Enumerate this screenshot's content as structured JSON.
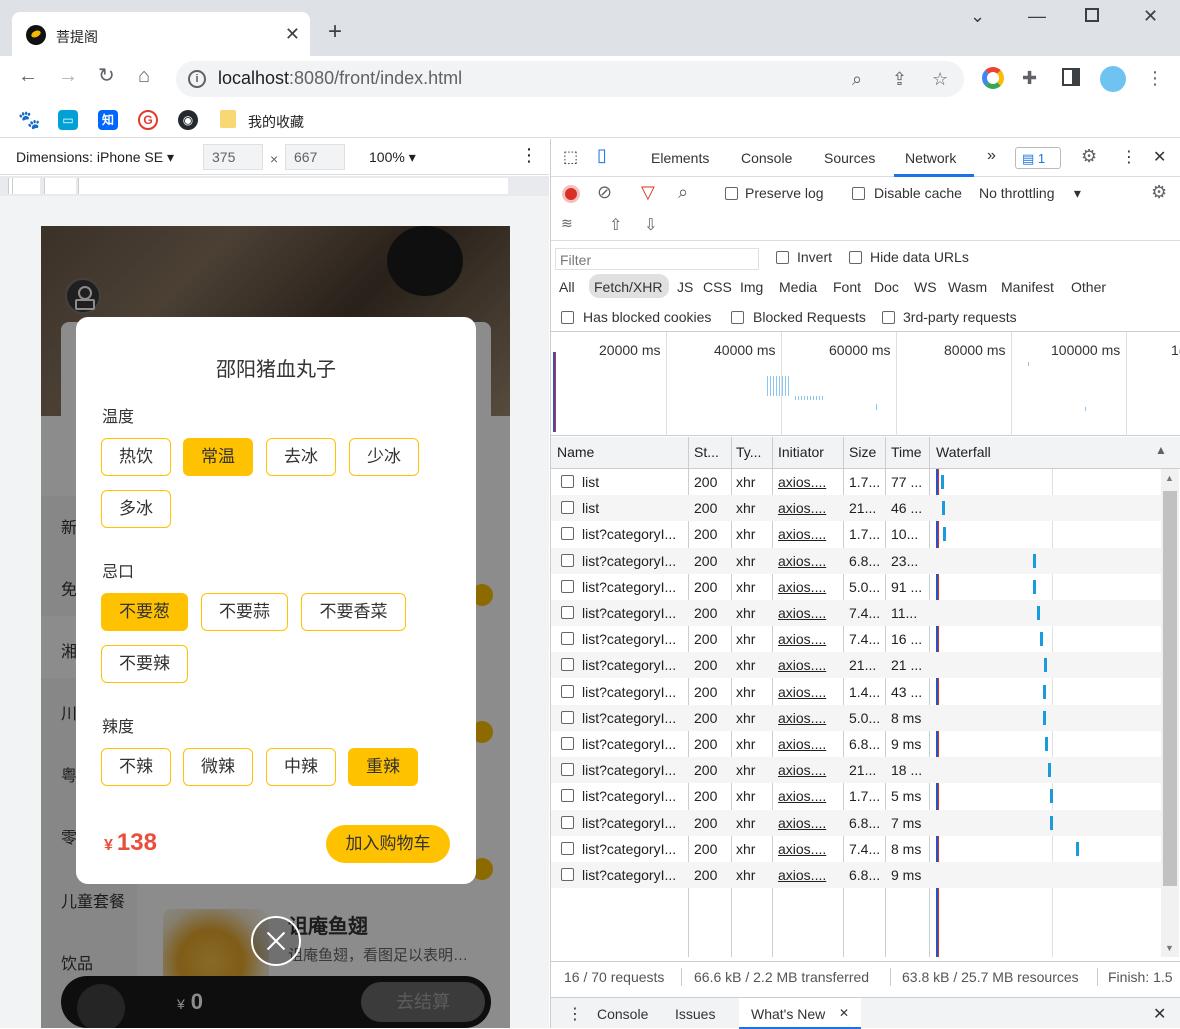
{
  "browser": {
    "tab_title": "菩提阁",
    "url_host": "localhost",
    "url_rest": ":8080/front/index.html",
    "bookmarks_folder": "我的收藏",
    "bookmark_zhihu": "知"
  },
  "device_toolbar": {
    "dimensions_label": "Dimensions: iPhone SE",
    "width": "375",
    "height": "667",
    "zoom": "100%"
  },
  "app": {
    "categories": [
      "新",
      "免",
      "湘",
      "川",
      "粤",
      "零",
      "儿童套餐",
      "饮品"
    ],
    "dish_name": "诅庵鱼翅",
    "dish_desc": "诅庵鱼翅，看图足以表明…",
    "cart_currency": "¥",
    "cart_total": "0",
    "checkout_label": "去结算"
  },
  "modal": {
    "title": "邵阳猪血丸子",
    "groups": [
      {
        "label": "温度",
        "options": [
          {
            "t": "热饮",
            "sel": false
          },
          {
            "t": "常温",
            "sel": true
          },
          {
            "t": "去冰",
            "sel": false
          },
          {
            "t": "少冰",
            "sel": false
          },
          {
            "t": "多冰",
            "sel": false
          }
        ]
      },
      {
        "label": "忌口",
        "options": [
          {
            "t": "不要葱",
            "sel": true
          },
          {
            "t": "不要蒜",
            "sel": false
          },
          {
            "t": "不要香菜",
            "sel": false
          },
          {
            "t": "不要辣",
            "sel": false
          }
        ]
      },
      {
        "label": "辣度",
        "options": [
          {
            "t": "不辣",
            "sel": false
          },
          {
            "t": "微辣",
            "sel": false
          },
          {
            "t": "中辣",
            "sel": false
          },
          {
            "t": "重辣",
            "sel": true
          }
        ]
      }
    ],
    "price_currency": "¥",
    "price": "138",
    "add_cart_label": "加入购物车"
  },
  "devtools": {
    "tabs": [
      "Elements",
      "Console",
      "Sources",
      "Network"
    ],
    "active_tab": "Network",
    "issues_count": "1",
    "preserve_log": "Preserve log",
    "disable_cache": "Disable cache",
    "throttling": "No throttling",
    "filter_placeholder": "Filter",
    "invert": "Invert",
    "hide_data_urls": "Hide data URLs",
    "type_filters": [
      "All",
      "Fetch/XHR",
      "JS",
      "CSS",
      "Img",
      "Media",
      "Font",
      "Doc",
      "WS",
      "Wasm",
      "Manifest",
      "Other"
    ],
    "active_type": "Fetch/XHR",
    "has_blocked_cookies": "Has blocked cookies",
    "blocked_requests": "Blocked Requests",
    "third_party": "3rd-party requests",
    "timeline_ticks": [
      "20000 ms",
      "40000 ms",
      "60000 ms",
      "80000 ms",
      "100000 ms",
      "1("
    ],
    "columns": [
      "Name",
      "St...",
      "Ty...",
      "Initiator",
      "Size",
      "Time",
      "Waterfall"
    ],
    "rows": [
      {
        "name": "list",
        "status": "200",
        "type": "xhr",
        "initiator": "axios....",
        "size": "1.7...",
        "time": "77 ..."
      },
      {
        "name": "list",
        "status": "200",
        "type": "xhr",
        "initiator": "axios....",
        "size": "21...",
        "time": "46 ..."
      },
      {
        "name": "list?categoryI...",
        "status": "200",
        "type": "xhr",
        "initiator": "axios....",
        "size": "1.7...",
        "time": "10..."
      },
      {
        "name": "list?categoryI...",
        "status": "200",
        "type": "xhr",
        "initiator": "axios....",
        "size": "6.8...",
        "time": "23..."
      },
      {
        "name": "list?categoryI...",
        "status": "200",
        "type": "xhr",
        "initiator": "axios....",
        "size": "5.0...",
        "time": "91 ..."
      },
      {
        "name": "list?categoryI...",
        "status": "200",
        "type": "xhr",
        "initiator": "axios....",
        "size": "7.4...",
        "time": "11..."
      },
      {
        "name": "list?categoryI...",
        "status": "200",
        "type": "xhr",
        "initiator": "axios....",
        "size": "7.4...",
        "time": "16 ..."
      },
      {
        "name": "list?categoryI...",
        "status": "200",
        "type": "xhr",
        "initiator": "axios....",
        "size": "21...",
        "time": "21 ..."
      },
      {
        "name": "list?categoryI...",
        "status": "200",
        "type": "xhr",
        "initiator": "axios....",
        "size": "1.4...",
        "time": "43 ..."
      },
      {
        "name": "list?categoryI...",
        "status": "200",
        "type": "xhr",
        "initiator": "axios....",
        "size": "5.0...",
        "time": "8 ms"
      },
      {
        "name": "list?categoryI...",
        "status": "200",
        "type": "xhr",
        "initiator": "axios....",
        "size": "6.8...",
        "time": "9 ms"
      },
      {
        "name": "list?categoryI...",
        "status": "200",
        "type": "xhr",
        "initiator": "axios....",
        "size": "21...",
        "time": "18 ..."
      },
      {
        "name": "list?categoryI...",
        "status": "200",
        "type": "xhr",
        "initiator": "axios....",
        "size": "1.7...",
        "time": "5 ms"
      },
      {
        "name": "list?categoryI...",
        "status": "200",
        "type": "xhr",
        "initiator": "axios....",
        "size": "6.8...",
        "time": "7 ms"
      },
      {
        "name": "list?categoryI...",
        "status": "200",
        "type": "xhr",
        "initiator": "axios....",
        "size": "7.4...",
        "time": "8 ms"
      },
      {
        "name": "list?categoryI...",
        "status": "200",
        "type": "xhr",
        "initiator": "axios....",
        "size": "6.8...",
        "time": "9 ms"
      }
    ],
    "status_requests": "16 / 70 requests",
    "status_transferred": "66.6 kB / 2.2 MB transferred",
    "status_resources": "63.8 kB / 25.7 MB resources",
    "status_finish": "Finish: 1.5",
    "drawer_tabs": [
      "Console",
      "Issues",
      "What's New"
    ]
  }
}
